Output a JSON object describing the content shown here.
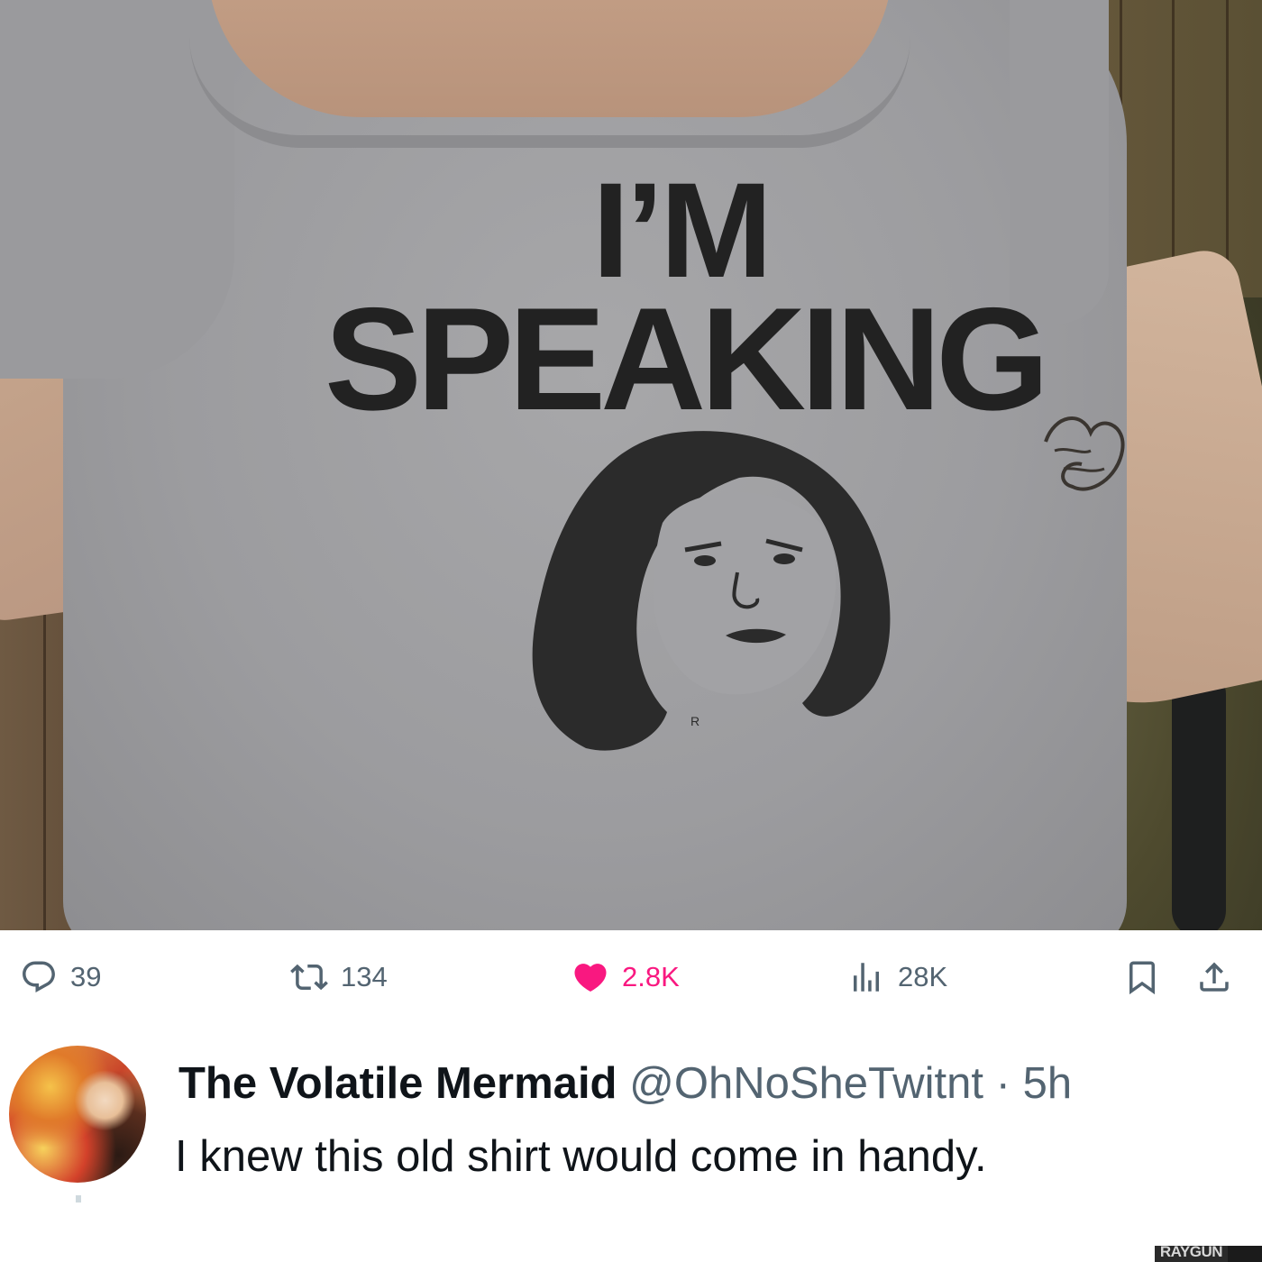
{
  "photo": {
    "shirt_line_1": "I’M",
    "shirt_line_2": "SPEAKING",
    "registered_mark": "R"
  },
  "watermark": "RAYGUN",
  "actions": {
    "replies": {
      "icon": "reply-icon",
      "count": "39"
    },
    "retweets": {
      "icon": "retweet-icon",
      "count": "134"
    },
    "likes": {
      "icon": "heart-icon",
      "count": "2.8K",
      "color": "#f91880"
    },
    "views": {
      "icon": "views-icon",
      "count": "28K"
    },
    "bookmark": {
      "icon": "bookmark-icon"
    },
    "share": {
      "icon": "share-icon"
    }
  },
  "tweet": {
    "author_name": "The Volatile Mermaid",
    "handle": "@OhNoSheTwitnt",
    "separator": "·",
    "time": "5h",
    "text": "I knew this old shirt would come in handy."
  },
  "colors": {
    "secondary_text": "#536471",
    "primary_text": "#0f1419",
    "like": "#f91880"
  }
}
